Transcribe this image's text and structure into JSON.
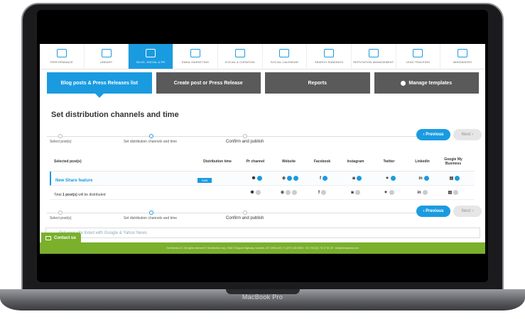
{
  "device": {
    "brand_label": "MacBook Pro"
  },
  "topnav": {
    "items": [
      {
        "label": "Performance",
        "icon": "chart-icon",
        "active": false
      },
      {
        "label": "Library",
        "icon": "library-icon",
        "active": false
      },
      {
        "label": "Blog, Social & PR",
        "icon": "blog-icon",
        "active": true
      },
      {
        "label": "Email Marketing",
        "icon": "megaphone-icon",
        "active": false
      },
      {
        "label": "Social & Curation",
        "icon": "social-icon",
        "active": false
      },
      {
        "label": "Social Calendar",
        "icon": "calendar-icon",
        "active": false
      },
      {
        "label": "Search Rankings",
        "icon": "rankings-icon",
        "active": false
      },
      {
        "label": "Reputation Management",
        "icon": "reputation-icon",
        "active": false
      },
      {
        "label": "Lead Tracking",
        "icon": "lead-icon",
        "active": false
      },
      {
        "label": "Minisahero",
        "icon": "hero-icon",
        "active": false
      }
    ]
  },
  "tabs": {
    "list": "Blog posts & Press Releases list",
    "create": "Create post or Press Release",
    "reports": "Reports",
    "templates": "Manage templates"
  },
  "page": {
    "title": "Set distribution channels and time"
  },
  "stepper": {
    "step1": "Select post(s)",
    "step2": "Set distribution channels and time",
    "step3": "Confirm and publish"
  },
  "buttons": {
    "previous": "Previous",
    "next": "Next"
  },
  "table": {
    "headers": {
      "posts": "Selected post(s)",
      "time": "Distribution time",
      "pr": "Pr channel",
      "website": "Website",
      "facebook": "Facebook",
      "instagram": "Instagram",
      "twitter": "Twitter",
      "linkedin": "LinkedIn",
      "gmb": "Google My Business"
    },
    "row": {
      "title": "New Share feature",
      "time": "now"
    },
    "total": {
      "prefix": "Total ",
      "count": "1 post(s)",
      "suffix": " will be distributed"
    },
    "glyphs": {
      "pr": "✺",
      "website": "⊕",
      "facebook": "f",
      "instagram": "◙",
      "twitter": "✦",
      "linkedin": "in",
      "gmb": "▤"
    }
  },
  "info_bar": {
    "text": "Get your site listed with Google & Yahoo News"
  },
  "contact": {
    "label": "Contact us"
  },
  "footer": {
    "text": "SeoSamba 2.0. All rights reserved © SeoSamba Corp. 2346 S Dupont Highway, Camden, DE 19934 US | +1 (877) 450 3894 · EU +33 (0)1 76 47 61 25 · info@seosamba.com"
  },
  "colors": {
    "accent": "#1a9be0",
    "green": "#7ab02c",
    "dark_tab": "#5a5a5a"
  }
}
